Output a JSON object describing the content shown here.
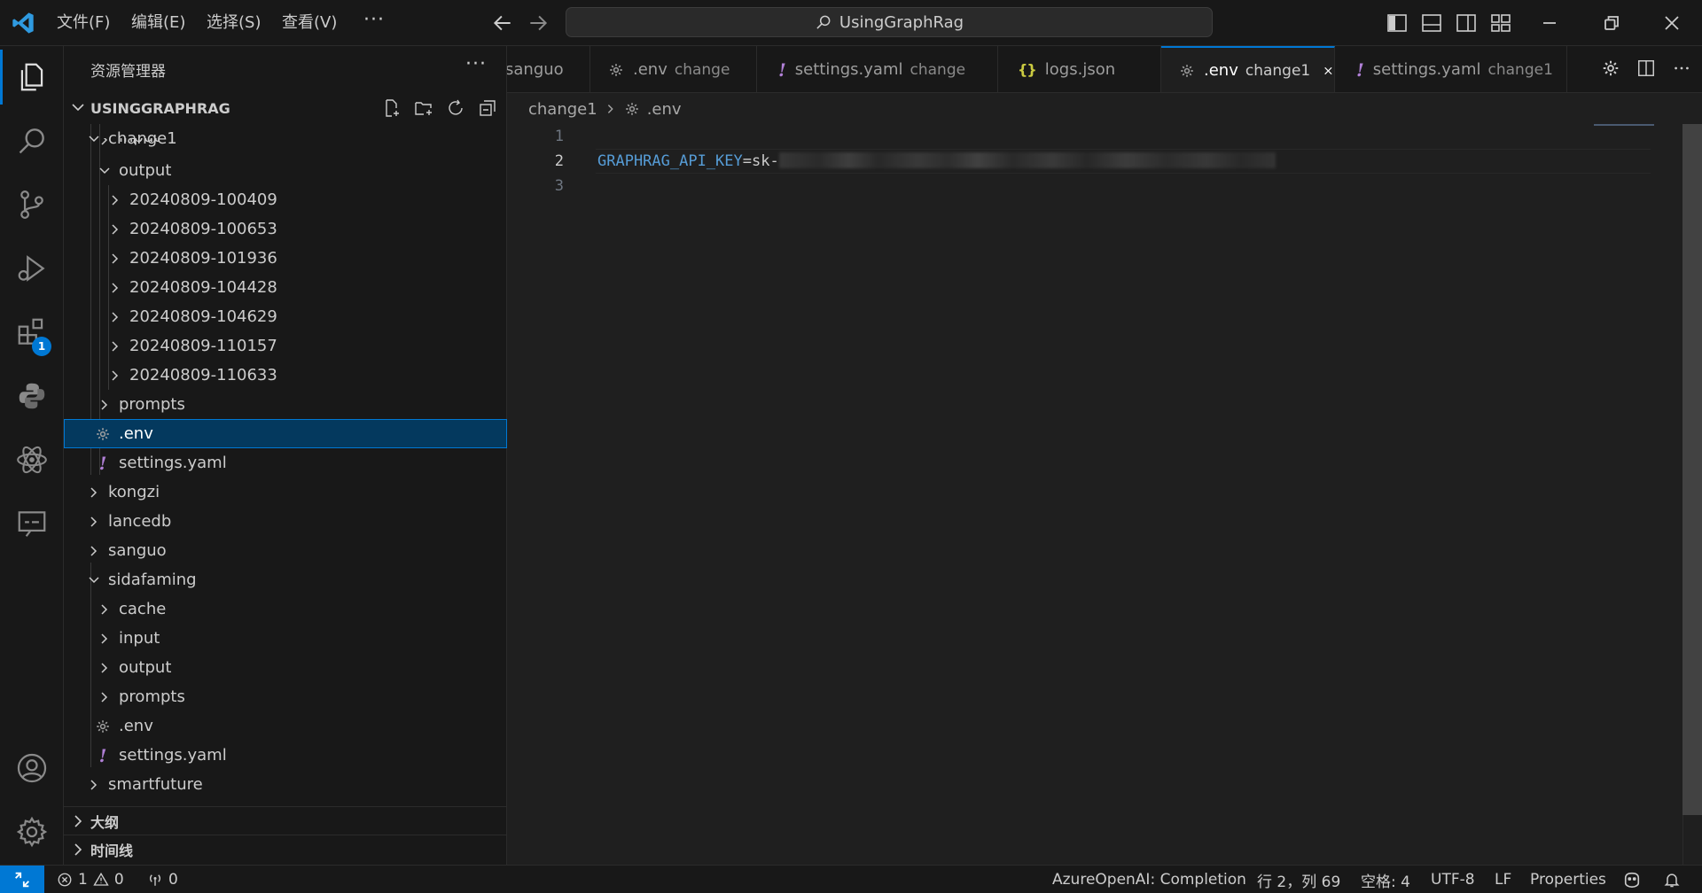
{
  "titlebar": {
    "menus": [
      "文件(F)",
      "编辑(E)",
      "选择(S)",
      "查看(V)"
    ],
    "more": "···",
    "command_center": "UsingGraphRag"
  },
  "activitybar": {
    "items": [
      "explorer-icon",
      "search-icon",
      "source-control-icon",
      "run-debug-icon",
      "extensions-icon",
      "python-icon",
      "react-icon",
      "remote-explorer-icon"
    ],
    "extensions_badge": "1",
    "bottom_items": [
      "account-icon",
      "manage-gear-icon"
    ]
  },
  "sidebar": {
    "title": "资源管理器",
    "more": "···",
    "folder": "USINGGRAPHRAG",
    "tree": [
      {
        "name": "change1",
        "type": "folder",
        "open": true,
        "depth": 0
      },
      {
        "name": "input",
        "type": "folder",
        "open": false,
        "depth": 1
      },
      {
        "name": "output",
        "type": "folder",
        "open": true,
        "depth": 1
      },
      {
        "name": "20240809-100409",
        "type": "folder",
        "open": false,
        "depth": 2
      },
      {
        "name": "20240809-100653",
        "type": "folder",
        "open": false,
        "depth": 2
      },
      {
        "name": "20240809-101936",
        "type": "folder",
        "open": false,
        "depth": 2
      },
      {
        "name": "20240809-104428",
        "type": "folder",
        "open": false,
        "depth": 2
      },
      {
        "name": "20240809-104629",
        "type": "folder",
        "open": false,
        "depth": 2
      },
      {
        "name": "20240809-110157",
        "type": "folder",
        "open": false,
        "depth": 2
      },
      {
        "name": "20240809-110633",
        "type": "folder",
        "open": false,
        "depth": 2
      },
      {
        "name": "prompts",
        "type": "folder",
        "open": false,
        "depth": 1
      },
      {
        "name": ".env",
        "type": "env",
        "depth": 1,
        "selected": true
      },
      {
        "name": "settings.yaml",
        "type": "yaml",
        "depth": 1
      },
      {
        "name": "kongzi",
        "type": "folder",
        "open": false,
        "depth": 0
      },
      {
        "name": "lancedb",
        "type": "folder",
        "open": false,
        "depth": 0
      },
      {
        "name": "sanguo",
        "type": "folder",
        "open": false,
        "depth": 0
      },
      {
        "name": "sidafaming",
        "type": "folder",
        "open": true,
        "depth": 0
      },
      {
        "name": "cache",
        "type": "folder",
        "open": false,
        "depth": 1
      },
      {
        "name": "input",
        "type": "folder",
        "open": false,
        "depth": 1
      },
      {
        "name": "output",
        "type": "folder",
        "open": false,
        "depth": 1
      },
      {
        "name": "prompts",
        "type": "folder",
        "open": false,
        "depth": 1
      },
      {
        "name": ".env",
        "type": "env",
        "depth": 1
      },
      {
        "name": "settings.yaml",
        "type": "yaml",
        "depth": 1
      },
      {
        "name": "smartfuture",
        "type": "folder",
        "open": false,
        "depth": 0
      }
    ],
    "outline": "大纲",
    "timeline": "时间线"
  },
  "tabs": [
    {
      "name": "sanguo",
      "desc": "",
      "icon": "none"
    },
    {
      "name": ".env",
      "desc": "change",
      "icon": "env"
    },
    {
      "name": "settings.yaml",
      "desc": "change",
      "icon": "yaml"
    },
    {
      "name": "logs.json",
      "desc": "",
      "icon": "json"
    },
    {
      "name": ".env",
      "desc": "change1",
      "icon": "env",
      "active": true
    },
    {
      "name": "settings.yaml",
      "desc": "change1",
      "icon": "yaml"
    }
  ],
  "breadcrumb": {
    "folder": "change1",
    "file": ".env"
  },
  "editor": {
    "line_numbers": [
      "1",
      "2",
      "3"
    ],
    "current_line": 2,
    "key": "GRAPHRAG_API_KEY",
    "value_prefix": "=sk-"
  },
  "statusbar": {
    "errors": "1",
    "warnings": "0",
    "ports": "0",
    "language_status": "AzureOpenAI: Completion",
    "cursor": "行 2，列 69",
    "indent": "空格: 4",
    "encoding": "UTF-8",
    "eol": "LF",
    "language": "Properties"
  },
  "colors": {
    "accent": "#0078d4",
    "env_key": "#569cd6",
    "yaml_icon": "#b180d7",
    "json_icon": "#cbcb41"
  }
}
